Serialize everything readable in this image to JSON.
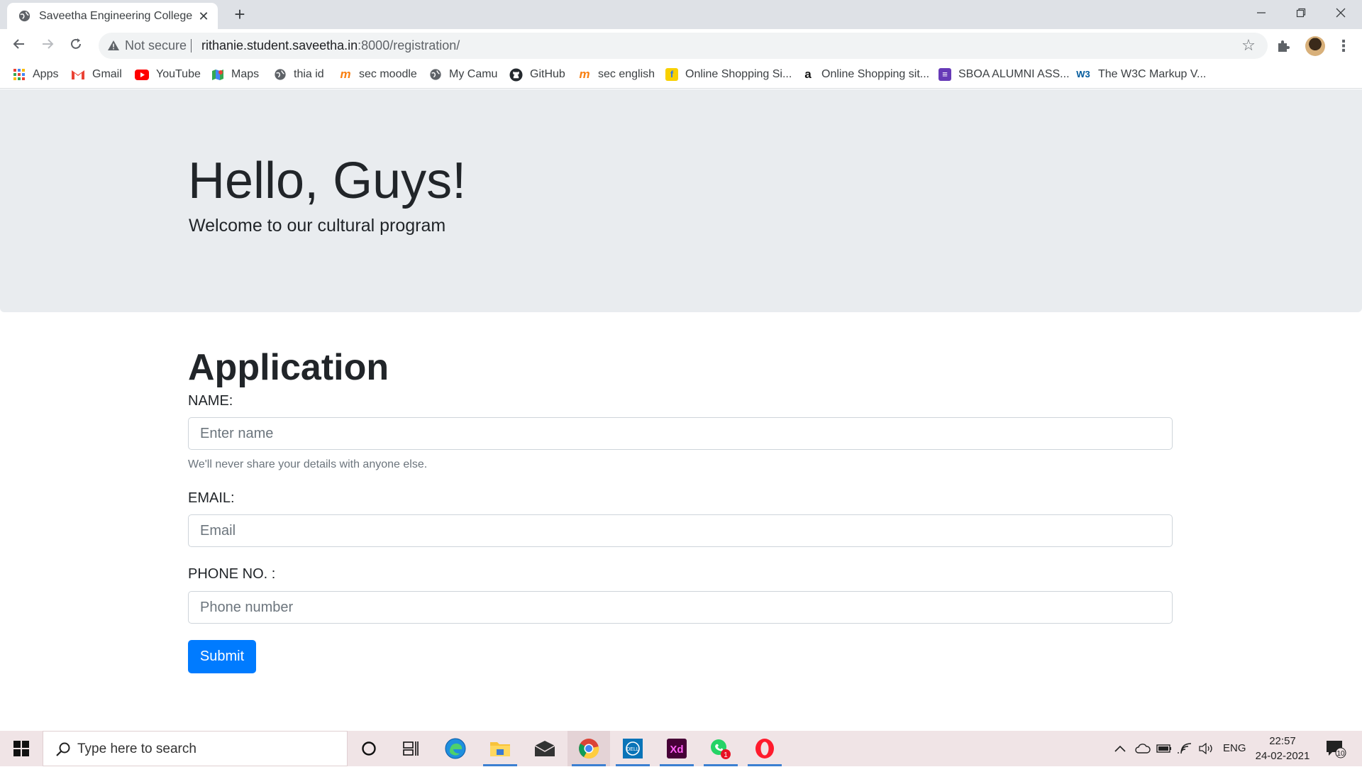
{
  "browser": {
    "tab_title": "Saveetha Engineering College",
    "tab_close": "✕",
    "new_tab": "+",
    "window_controls": {
      "minimize": "—",
      "maximize": "❐",
      "close": "✕"
    },
    "nav": {
      "back": "←",
      "forward": "→",
      "reload": "↻"
    },
    "omnibox": {
      "security_label": "Not secure",
      "url_host": "rithanie.student.saveetha.in",
      "url_rest": ":8000/registration/"
    },
    "bookmarks": [
      {
        "label": "Apps",
        "icon": "apps-grid-icon"
      },
      {
        "label": "Gmail",
        "icon": "gmail-icon"
      },
      {
        "label": "YouTube",
        "icon": "youtube-icon"
      },
      {
        "label": "Maps",
        "icon": "maps-icon"
      },
      {
        "label": "thia id",
        "icon": "globe-icon"
      },
      {
        "label": "sec moodle",
        "icon": "moodle-icon"
      },
      {
        "label": "My Camu",
        "icon": "globe-icon"
      },
      {
        "label": "GitHub",
        "icon": "github-icon"
      },
      {
        "label": "sec english",
        "icon": "moodle-icon"
      },
      {
        "label": "Online Shopping Si...",
        "icon": "flipkart-icon"
      },
      {
        "label": "Online Shopping sit...",
        "icon": "amazon-icon"
      },
      {
        "label": "SBOA ALUMNI ASS...",
        "icon": "forms-icon"
      },
      {
        "label": "The W3C Markup V...",
        "icon": "w3c-icon"
      }
    ]
  },
  "hero": {
    "title": "Hello, Guys!",
    "subtitle": "Welcome to our cultural program"
  },
  "form": {
    "heading": "Application",
    "name_label": "NAME:",
    "name_placeholder": "Enter name",
    "name_help": "We'll never share your details with anyone else.",
    "email_label": "EMAIL:",
    "email_placeholder": "Email",
    "phone_label": "PHONE NO. :",
    "phone_placeholder": "Phone number",
    "submit_label": "Submit"
  },
  "taskbar": {
    "search_placeholder": "Type here to search",
    "language": "ENG",
    "time": "22:57",
    "date": "24-02-2021",
    "notification_count": "10",
    "whatsapp_badge": "1"
  },
  "colors": {
    "accent": "#007bff",
    "jumbotron_bg": "#e9ecef",
    "chrome_bg": "#dee1e6"
  }
}
